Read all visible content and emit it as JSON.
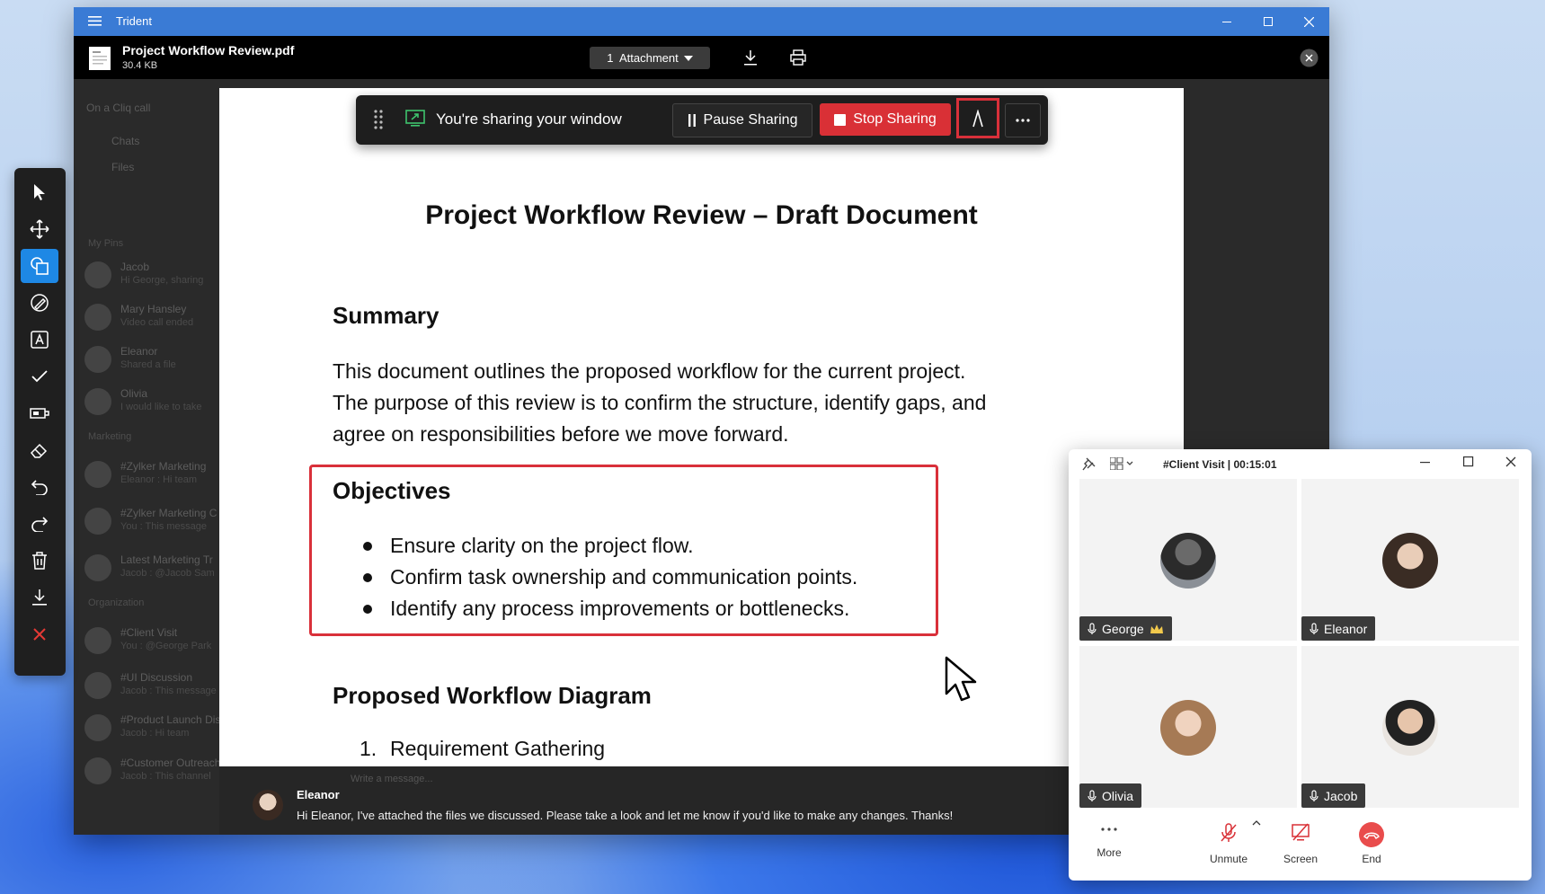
{
  "window": {
    "app_title": "Trident"
  },
  "file": {
    "name": "Project Workflow Review.pdf",
    "size": "30.4 KB",
    "attachment_label": "1  Attachment"
  },
  "sidebar": {
    "call_label": "On a Cliq call",
    "nav": [
      "Chats",
      "Files"
    ],
    "sections": {
      "pins": "My Pins",
      "marketing": "Marketing",
      "organization": "Organization"
    },
    "pins": [
      {
        "name": "Jacob",
        "sub": "Hi George, sharing"
      },
      {
        "name": "Mary Hansley",
        "sub": "Video call ended"
      },
      {
        "name": "Eleanor",
        "sub": "Shared a file"
      },
      {
        "name": "Olivia",
        "sub": "I would like to take"
      }
    ],
    "marketing": [
      {
        "name": "#Zylker Marketing",
        "sub": "Eleanor : Hi team"
      },
      {
        "name": "#Zylker Marketing C",
        "sub": "You : This message"
      },
      {
        "name": "Latest Marketing Tr",
        "sub": "Jacob : @Jacob Sam"
      }
    ],
    "organization": [
      {
        "name": "#Client Visit",
        "sub": "You : @George Park"
      },
      {
        "name": "#UI Discussion",
        "sub": "Jacob : This message"
      },
      {
        "name": "#Product Launch Discussion",
        "sub": "Jacob : Hi team"
      },
      {
        "name": "#Customer Outreach",
        "sub": "Jacob : This channel"
      }
    ]
  },
  "share_bar": {
    "status": "You're sharing your window",
    "pause_label": "Pause Sharing",
    "stop_label": "Stop Sharing"
  },
  "document": {
    "title": "Project Workflow Review – Draft Document",
    "summary_heading": "Summary",
    "summary_lines": [
      "This document outlines the proposed workflow for the current project.",
      "The purpose of this review is to confirm the structure, identify gaps, and",
      "agree on responsibilities before we move forward."
    ],
    "objectives_heading": "Objectives",
    "objectives": [
      "Ensure clarity on the project flow.",
      "Confirm task ownership and communication points.",
      "Identify any process improvements or bottlenecks."
    ],
    "diagram_heading": "Proposed Workflow Diagram",
    "diagram_item_num": "1.",
    "diagram_item": "Requirement Gathering"
  },
  "chat": {
    "placeholder": "Write a message...",
    "sender": "Eleanor",
    "message": "Hi Eleanor, I've attached the files we discussed. Please take a look and let me know if you'd like to make any changes. Thanks!"
  },
  "call": {
    "title": "#Client Visit | 00:15:01",
    "participants": [
      {
        "name": "George",
        "host": true
      },
      {
        "name": "Eleanor"
      },
      {
        "name": "Olivia"
      },
      {
        "name": "Jacob"
      }
    ],
    "controls": {
      "more": "More",
      "unmute": "Unmute",
      "screen": "Screen",
      "end": "End"
    }
  },
  "colors": {
    "accent": "#3a7bd5",
    "danger": "#d93036",
    "active_tool": "#1e88e5"
  }
}
